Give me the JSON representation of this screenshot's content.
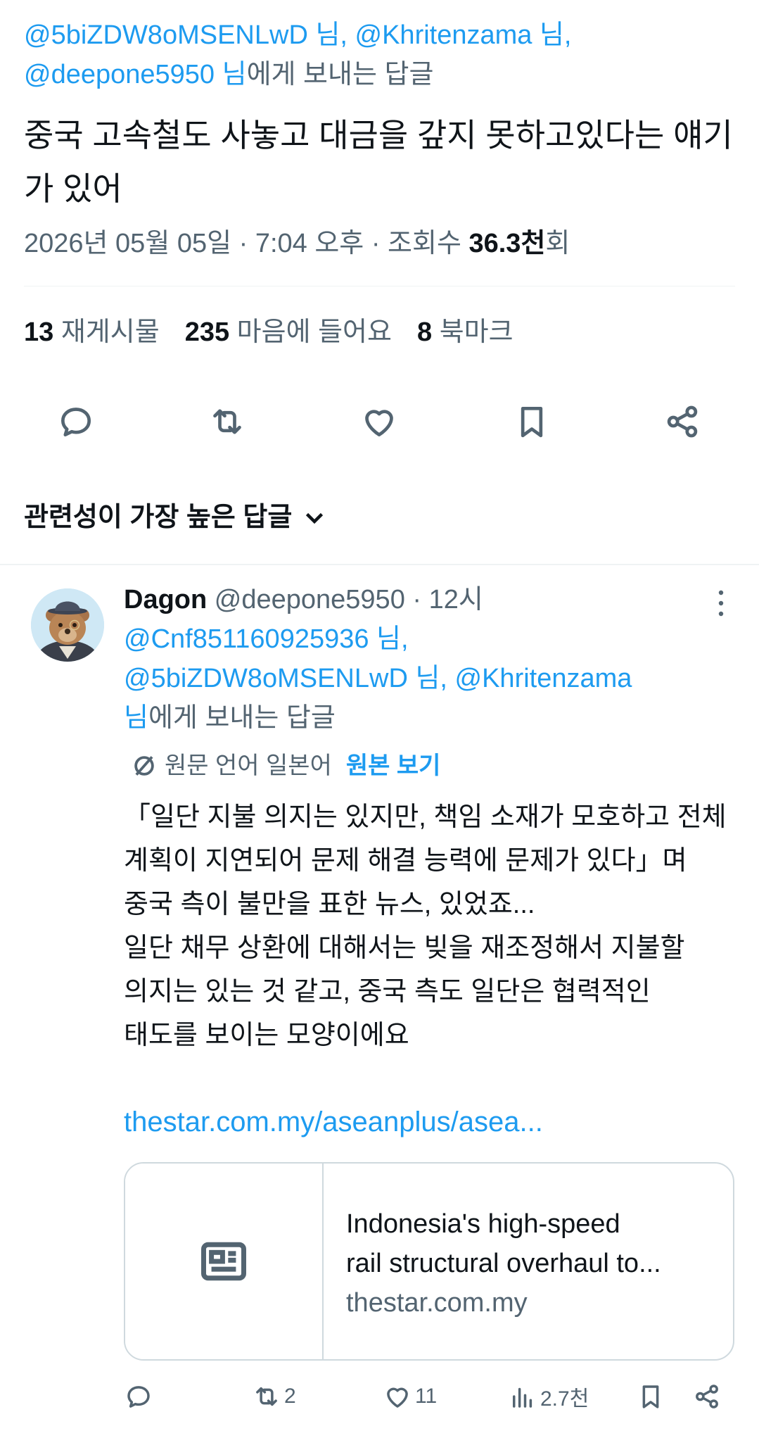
{
  "top_tweet": {
    "reply_to_line1_links": "@5biZDW8oMSENLwD 님, @Khritenzama 님,",
    "reply_to_line2_link": "@deepone5950 님",
    "reply_to_suffix": "에게 보내는 답글",
    "text": "중국 고속철도 사놓고 대금을 갚지 못하고있다는 얘기가 있어",
    "meta_date": "2026년 05월 05일 · 7:04 오후 · 조회수 ",
    "meta_views": "36.3천",
    "meta_views_suffix": "회",
    "stats": {
      "reposts_count": "13",
      "reposts_label": "재게시물",
      "likes_count": "235",
      "likes_label": "마음에 들어요",
      "bookmarks_count": "8",
      "bookmarks_label": "북마크"
    }
  },
  "sort": {
    "label": "관련성이 가장 높은 답글"
  },
  "reply": {
    "display_name": "Dagon",
    "handle": "@deepone5950",
    "time": " · 12시",
    "reply_to_line1": "@Cnf851160925936 님,",
    "reply_to_line2": "@5biZDW8oMSENLwD 님, @Khritenzama",
    "reply_to_line3_link": "님",
    "reply_to_suffix": "에게 보내는 답글",
    "translate_label": "원문 언어 일본어",
    "original_link": "원본 보기",
    "text": "「일단 지불 의지는 있지만, 책임 소재가 모호하고 전체 계획이 지연되어 문제 해결 능력에 문제가 있다」며\n중국 측이 불만을 표한 뉴스, 있었죠...\n일단 채무 상환에 대해서는 빚을 재조정해서 지불할\n의지는 있는 것 같고, 중국 측도 일단은 협력적인\n태도를 보이는 모양이에요",
    "link_text": "thestar.com.my/aseanplus/asea...",
    "card": {
      "title_line1": "Indonesia's high-speed",
      "title_line2": "rail structural overhaul to...",
      "domain": "thestar.com.my"
    },
    "actions": {
      "reposts": "2",
      "likes": "11",
      "views": "2.7천"
    }
  },
  "icons": {
    "reply": "reply-icon",
    "repost": "repost-icon",
    "like": "heart-icon",
    "bookmark": "bookmark-icon",
    "share": "share-icon",
    "views": "views-icon",
    "more": "more-vertical-icon",
    "translate": "translate-icon",
    "article": "article-icon",
    "chevron": "chevron-down-icon"
  }
}
